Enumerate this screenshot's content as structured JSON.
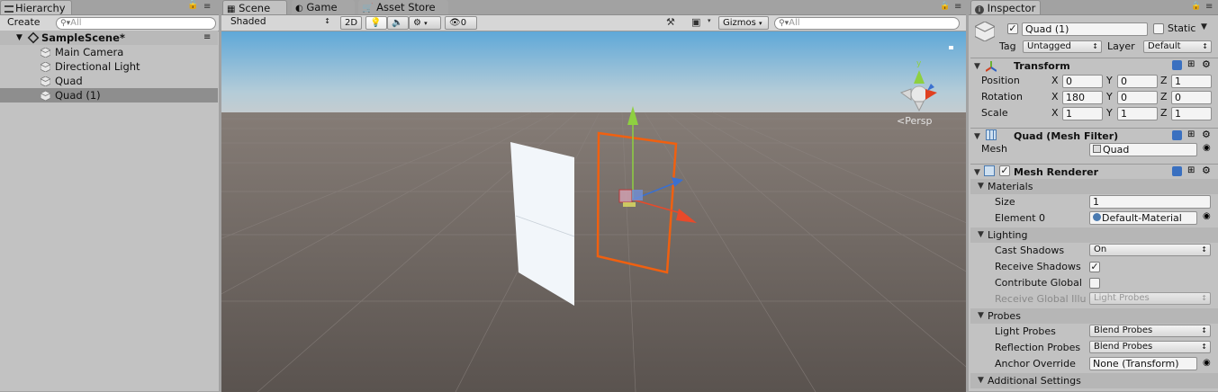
{
  "hierarchy": {
    "tab_label": "Hierarchy",
    "create_label": "Create",
    "search_placeholder": "All",
    "scene_name": "SampleScene*",
    "items": [
      {
        "label": "Main Camera"
      },
      {
        "label": "Directional Light"
      },
      {
        "label": "Quad"
      },
      {
        "label": "Quad (1)"
      }
    ]
  },
  "scene": {
    "tabs": [
      {
        "label": "Scene"
      },
      {
        "label": "Game"
      },
      {
        "label": "Asset Store"
      }
    ],
    "shading_mode": "Shaded",
    "mode_2d": "2D",
    "hidden_count": "0",
    "gizmos_label": "Gizmos",
    "search_placeholder": "All",
    "persp_label": "Persp"
  },
  "inspector": {
    "tab_label": "Inspector",
    "object_name": "Quad (1)",
    "static_label": "Static",
    "tag_label": "Tag",
    "tag_value": "Untagged",
    "layer_label": "Layer",
    "layer_value": "Default",
    "transform": {
      "title": "Transform",
      "position_label": "Position",
      "rotation_label": "Rotation",
      "scale_label": "Scale",
      "axis_x": "X",
      "axis_y": "Y",
      "axis_z": "Z",
      "position": [
        "0",
        "0",
        "1"
      ],
      "rotation": [
        "180",
        "0",
        "0"
      ],
      "scale": [
        "1",
        "1",
        "1"
      ]
    },
    "mesh_filter": {
      "title": "Quad (Mesh Filter)",
      "mesh_label": "Mesh",
      "mesh_value": "Quad"
    },
    "mesh_renderer": {
      "title": "Mesh Renderer",
      "materials_label": "Materials",
      "size_label": "Size",
      "size_value": "1",
      "element0_label": "Element 0",
      "element0_value": "Default-Material",
      "lighting_label": "Lighting",
      "cast_shadows_label": "Cast Shadows",
      "cast_shadows_value": "On",
      "receive_shadows_label": "Receive Shadows",
      "receive_shadows_checked": true,
      "contribute_gi_label": "Contribute Global",
      "receive_gi_label": "Receive Global Illu",
      "receive_gi_value": "Light Probes",
      "probes_label": "Probes",
      "light_probes_label": "Light Probes",
      "light_probes_value": "Blend Probes",
      "reflection_probes_label": "Reflection Probes",
      "reflection_probes_value": "Blend Probes",
      "anchor_override_label": "Anchor Override",
      "anchor_override_value": "None (Transform)",
      "additional_settings_label": "Additional Settings"
    }
  }
}
